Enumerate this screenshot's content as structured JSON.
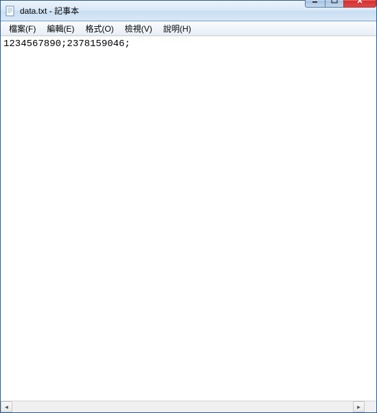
{
  "window": {
    "title": "data.txt - 記事本"
  },
  "menubar": {
    "items": [
      {
        "label": "檔案(F)"
      },
      {
        "label": "編輯(E)"
      },
      {
        "label": "格式(O)"
      },
      {
        "label": "檢視(V)"
      },
      {
        "label": "說明(H)"
      }
    ]
  },
  "editor": {
    "content": "1234567890;2378159046;"
  }
}
